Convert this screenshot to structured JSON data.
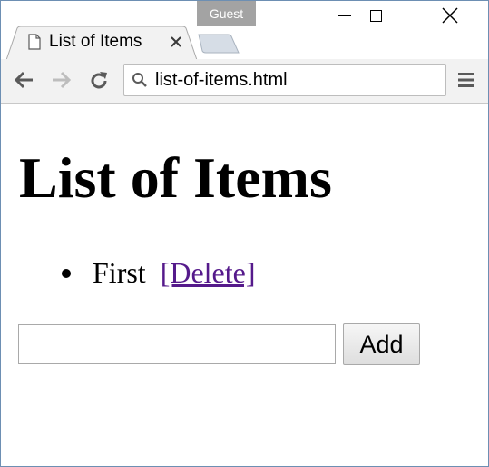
{
  "window": {
    "profile_badge": "Guest",
    "minimize_icon": "minimize-icon",
    "maximize_icon": "maximize-icon",
    "close_icon": "close-icon"
  },
  "tab": {
    "title": "List of Items",
    "icon": "file-icon",
    "close_icon": "close-icon"
  },
  "toolbar": {
    "back_icon": "back-arrow-icon",
    "forward_icon": "forward-arrow-icon",
    "reload_icon": "reload-icon",
    "url": "list-of-items.html",
    "search_icon": "search-icon",
    "menu_icon": "menu-icon"
  },
  "page": {
    "heading": "List of Items",
    "items": [
      {
        "text": "First",
        "delete_label": "[Delete]"
      }
    ],
    "input_value": "",
    "add_label": "Add",
    "link_color": "#551a8b"
  }
}
